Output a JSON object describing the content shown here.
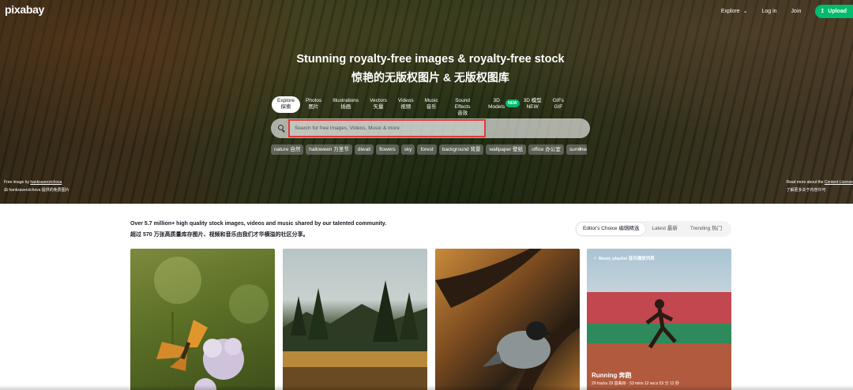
{
  "brand": {
    "logo": "pixabay",
    "accent": "#02bb6c",
    "highlight": "#e5393b"
  },
  "topnav": {
    "explore": "Explore",
    "login": "Log in",
    "join": "Join",
    "upload": "Upload"
  },
  "hero": {
    "headline": "Stunning royalty-free images & royalty-free stock",
    "headline_zh": "惊艳的无版权图片 & 无版权图库",
    "tabs": [
      {
        "label": "Explore",
        "label_zh": "探索",
        "active": true
      },
      {
        "label": "Photos",
        "label_zh": "图片"
      },
      {
        "label": "Illustrations",
        "label_zh": "插画"
      },
      {
        "label": "Vectors",
        "label_zh": "矢量"
      },
      {
        "label": "Videos",
        "label_zh": "视频"
      },
      {
        "label": "Music",
        "label_zh": "音乐"
      },
      {
        "label": "Sound Effects",
        "label_zh": "音效"
      },
      {
        "label": "3D Models",
        "label_zh": "",
        "badge": "NEW"
      },
      {
        "label": "3D 模型",
        "label_zh": "NEW"
      },
      {
        "label": "GIFs",
        "label_zh": "GIF"
      }
    ],
    "search_placeholder": "Search for free Images, Videos, Music & more",
    "chips": [
      "nature 自然",
      "halloween 万圣节",
      "diwali",
      "flowers",
      "sky",
      "forest",
      "background 背景",
      "wallpaper 壁纸",
      "office 办公室",
      "summer"
    ],
    "credit_left_prefix": "Free image by ",
    "credit_left_user": "hanksaverzichova",
    "credit_left_zh": "由 hanksaverzichova 提供的免费图片",
    "credit_right_prefix": "Read more about the ",
    "credit_right_link": "Content License",
    "credit_right_zh": "了解更多关于内容许可"
  },
  "intro": {
    "line1": "Over 5.7 million+ high quality stock images, videos and music shared by our talented community.",
    "line2": "超过 570 万张高质量库存图片、视频和音乐由我们才华横溢的社区分享。"
  },
  "sort": [
    "Editor's Choice 编辑精选",
    "Latest 最新",
    "Trending 热门"
  ],
  "playlist": {
    "label": "Music playlist 音乐播放列表",
    "title": "Running 奔跑",
    "meta": "29 tracks 29 首曲目 · 53 mins 12 secs 53 分 12 秒"
  }
}
